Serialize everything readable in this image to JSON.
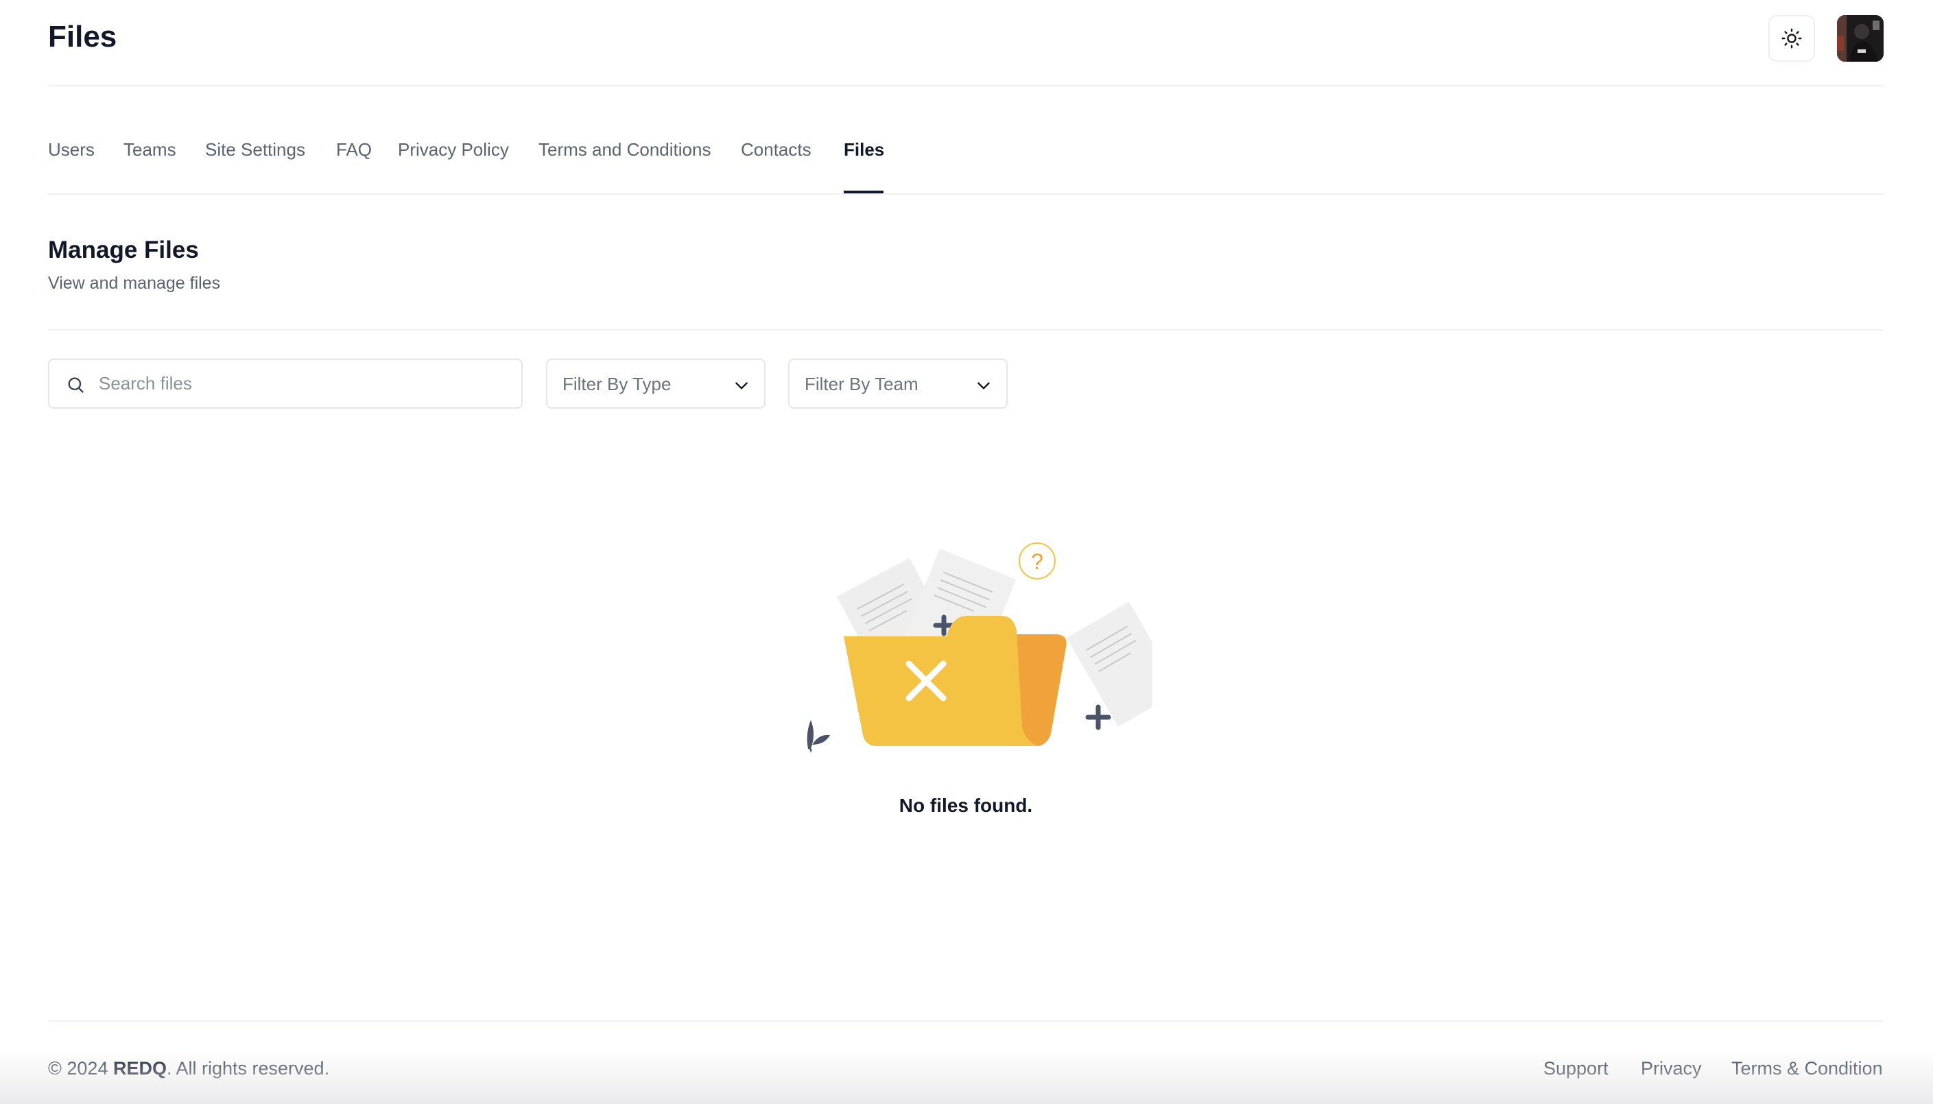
{
  "header": {
    "title": "Files",
    "theme_toggle_icon": "sun-icon",
    "avatar_icon": "user-avatar"
  },
  "tabs": [
    {
      "label": "Users",
      "active": false
    },
    {
      "label": "Teams",
      "active": false
    },
    {
      "label": "Site Settings",
      "active": false
    },
    {
      "label": "FAQ",
      "active": false
    },
    {
      "label": "Privacy Policy",
      "active": false
    },
    {
      "label": "Terms and Conditions",
      "active": false
    },
    {
      "label": "Contacts",
      "active": false
    },
    {
      "label": "Files",
      "active": true
    }
  ],
  "section": {
    "title": "Manage Files",
    "subtitle": "View and manage files"
  },
  "filters": {
    "search_placeholder": "Search files",
    "search_value": "",
    "type_placeholder": "Filter By Type",
    "team_placeholder": "Filter By Team"
  },
  "empty_state": {
    "message": "No files found.",
    "illustration_icon": "empty-folder-icon"
  },
  "footer": {
    "copyright_prefix": "© 2024 ",
    "brand": "REDQ",
    "copyright_suffix": ". All rights reserved.",
    "links": [
      "Support",
      "Privacy",
      "Terms & Condition"
    ]
  },
  "colors": {
    "text_primary": "#111827",
    "text_muted": "#5b6270",
    "border": "#e5e7eb",
    "folder_yellow": "#f5c343",
    "folder_orange": "#f0a23b"
  }
}
